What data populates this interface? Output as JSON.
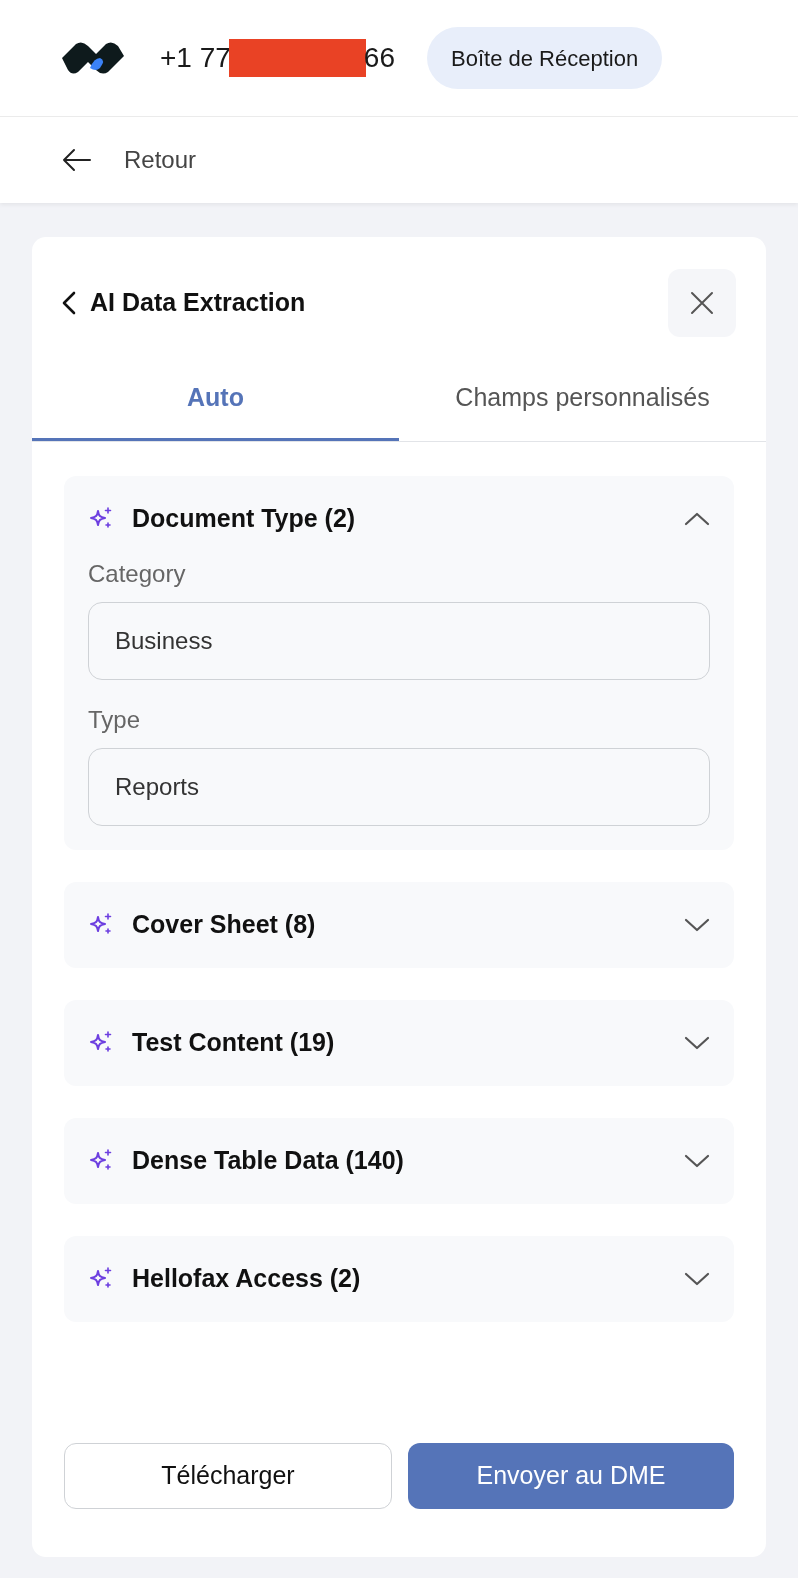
{
  "header": {
    "phone_start": "+1 77",
    "redacted": true,
    "phone_end": "66",
    "inbox_button": "Boîte de Réception"
  },
  "back_bar": {
    "label": "Retour"
  },
  "panel": {
    "title": "AI Data Extraction",
    "tabs": [
      {
        "label": "Auto",
        "selected": true
      },
      {
        "label": "Champs personnalisés",
        "selected": false
      }
    ],
    "sections": [
      {
        "title": "Document Type (2)",
        "expanded": true,
        "fields": [
          {
            "label": "Category",
            "value": "Business"
          },
          {
            "label": "Type",
            "value": "Reports"
          }
        ]
      },
      {
        "title": "Cover Sheet (8)",
        "expanded": false
      },
      {
        "title": "Test Content (19)",
        "expanded": false
      },
      {
        "title": "Dense Table Data (140)",
        "expanded": false
      },
      {
        "title": "Hellofax Access (2)",
        "expanded": false
      }
    ],
    "buttons": [
      {
        "label": "Télécharger",
        "kind": "secondary"
      },
      {
        "label": "Envoyer au DME",
        "kind": "primary"
      }
    ]
  }
}
